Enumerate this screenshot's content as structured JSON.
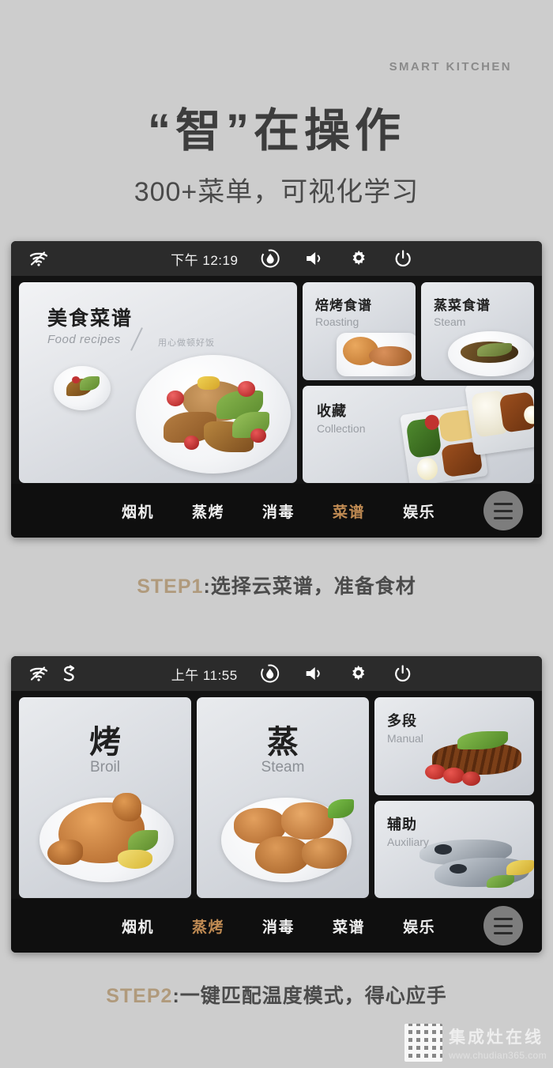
{
  "header": {
    "eyebrow": "SMART  KITCHEN",
    "headline": "“智”在操作",
    "subline": "300+菜单，可视化学习"
  },
  "screen1": {
    "statusbar": {
      "time": "下午 12:19",
      "icons": [
        "wifi-off-icon",
        "humidity-icon",
        "volume-icon",
        "gear-icon",
        "power-icon"
      ]
    },
    "cards": {
      "main": {
        "title": "美食菜谱",
        "subtitle": "Food recipes",
        "tagline": "用心做顿好饭"
      },
      "roasting": {
        "title": "焙烤食谱",
        "subtitle": "Roasting"
      },
      "steam": {
        "title": "蒸菜食谱",
        "subtitle": "Steam"
      },
      "collection": {
        "title": "收藏",
        "subtitle": "Collection"
      }
    },
    "nav": {
      "items": [
        {
          "label": "烟机",
          "active": false
        },
        {
          "label": "蒸烤",
          "active": false
        },
        {
          "label": "消毒",
          "active": false
        },
        {
          "label": "菜谱",
          "active": true
        },
        {
          "label": "娱乐",
          "active": false
        }
      ],
      "menu_icon": "hamburger-menu-icon"
    }
  },
  "step1": {
    "num": "STEP1",
    "text": ":选择云菜谱，准备食材"
  },
  "screen2": {
    "statusbar": {
      "time": "上午 11:55",
      "icons": [
        "wifi-off-icon",
        "sync-icon",
        "humidity-icon",
        "volume-icon",
        "gear-icon",
        "power-icon"
      ]
    },
    "cards": {
      "broil": {
        "title": "烤",
        "subtitle": "Broil"
      },
      "steam": {
        "title": "蒸",
        "subtitle": "Steam"
      },
      "manual": {
        "title": "多段",
        "subtitle": "Manual"
      },
      "auxiliary": {
        "title": "辅助",
        "subtitle": "Auxiliary"
      }
    },
    "nav": {
      "items": [
        {
          "label": "烟机",
          "active": false
        },
        {
          "label": "蒸烤",
          "active": true
        },
        {
          "label": "消毒",
          "active": false
        },
        {
          "label": "菜谱",
          "active": false
        },
        {
          "label": "娱乐",
          "active": false
        }
      ],
      "menu_icon": "hamburger-menu-icon"
    }
  },
  "step2": {
    "num": "STEP2",
    "text": ":一键匹配温度模式，得心应手"
  },
  "watermark": {
    "name": "集成灶在线",
    "url": "www.chudian365.com"
  },
  "colors": {
    "page_bg": "#cdcdcd",
    "accent_nav": "#c08b53",
    "accent_step": "#b09a7c",
    "device_bg": "#131313",
    "statusbar_bg": "#2b2b2b"
  }
}
